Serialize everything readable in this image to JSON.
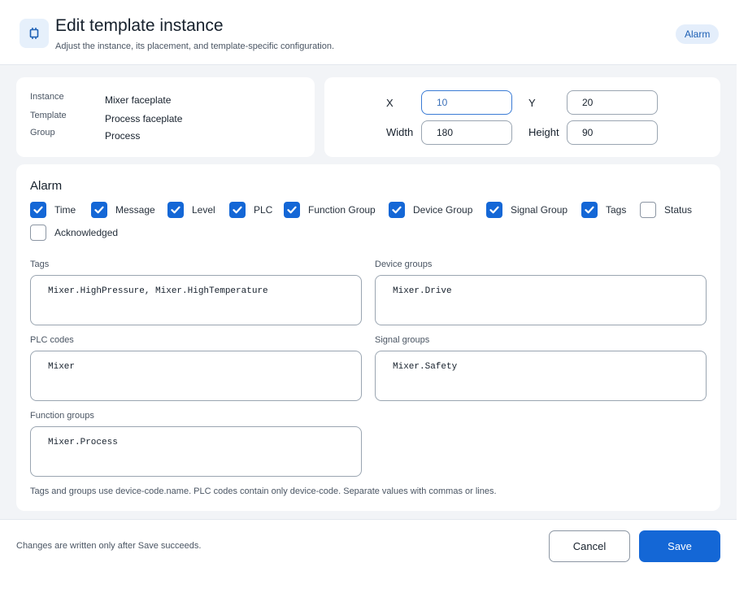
{
  "header": {
    "icon": "chip-icon",
    "title": "Edit template instance",
    "subtitle": "Adjust the instance, its placement, and template-specific configuration.",
    "badge": "Alarm"
  },
  "info": {
    "instance_label": "Instance",
    "instance_value": "Mixer faceplate",
    "template_label": "Template",
    "template_value": "Process faceplate",
    "group_label": "Group",
    "group_value": "Process"
  },
  "position": {
    "x_label": "X",
    "x_value": "10",
    "y_label": "Y",
    "y_value": "20",
    "width_label": "Width",
    "width_value": "180",
    "height_label": "Height",
    "height_value": "90"
  },
  "alarm": {
    "title": "Alarm",
    "columns": [
      {
        "label": "Time",
        "checked": true
      },
      {
        "label": "Message",
        "checked": true
      },
      {
        "label": "Level",
        "checked": true
      },
      {
        "label": "PLC",
        "checked": true
      },
      {
        "label": "Function Group",
        "checked": true
      },
      {
        "label": "Device Group",
        "checked": true
      },
      {
        "label": "Signal Group",
        "checked": true
      },
      {
        "label": "Tags",
        "checked": true
      },
      {
        "label": "Status",
        "checked": false
      },
      {
        "label": "Acknowledged",
        "checked": false
      }
    ],
    "fields": {
      "tags_label": "Tags",
      "tags_value": "Mixer.HighPressure, Mixer.HighTemperature",
      "device_groups_label": "Device groups",
      "device_groups_value": "Mixer.Drive",
      "plc_codes_label": "PLC codes",
      "plc_codes_value": "Mixer",
      "signal_groups_label": "Signal groups",
      "signal_groups_value": "Mixer.Safety",
      "function_groups_label": "Function groups",
      "function_groups_value": "Mixer.Process"
    },
    "help": "Tags and groups use device-code.name. PLC codes contain only device-code. Separate values with commas or lines."
  },
  "footer": {
    "note": "Changes are written only after Save succeeds.",
    "cancel_label": "Cancel",
    "save_label": "Save"
  },
  "colors": {
    "accent": "#1467d6",
    "badge_bg": "#e4eefb",
    "panel_bg": "#f2f4f7"
  }
}
